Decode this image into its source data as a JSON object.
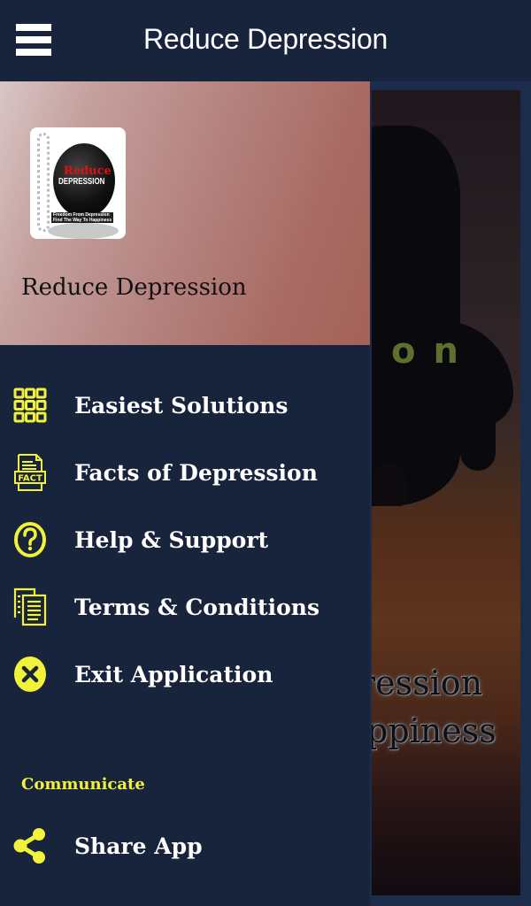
{
  "app_bar": {
    "menu_icon": "hamburger-menu-icon",
    "title": "Reduce Depression"
  },
  "drawer": {
    "header": {
      "logo": {
        "icon": "app-logo-wrecking-ball",
        "line1": "Reduce",
        "line2": "DEPRESSION",
        "tagline1": "Freedom From Depression",
        "tagline2": "Find The Way To Happiness"
      },
      "title": "Reduce Depression"
    },
    "items": [
      {
        "icon": "grid-icon",
        "label": "Easiest Solutions"
      },
      {
        "icon": "fact-document-icon",
        "label": "Facts of Depression",
        "icon_text": "FACT"
      },
      {
        "icon": "help-circle-icon",
        "label": "Help & Support"
      },
      {
        "icon": "documents-icon",
        "label": "Terms & Conditions"
      },
      {
        "icon": "close-circle-icon",
        "label": "Exit Application"
      }
    ],
    "section": {
      "label": "Communicate",
      "items": [
        {
          "icon": "share-icon",
          "label": "Share App"
        }
      ]
    }
  },
  "background_banner": {
    "partial_text": "on",
    "quote_line1": "ression",
    "quote_line2": "ppiness"
  },
  "colors": {
    "app_bar": "#18233c",
    "drawer_bg": "#18233c",
    "icon_accent": "#f2f23a",
    "section_label": "#f2f23a",
    "menu_text": "#ffffff"
  }
}
